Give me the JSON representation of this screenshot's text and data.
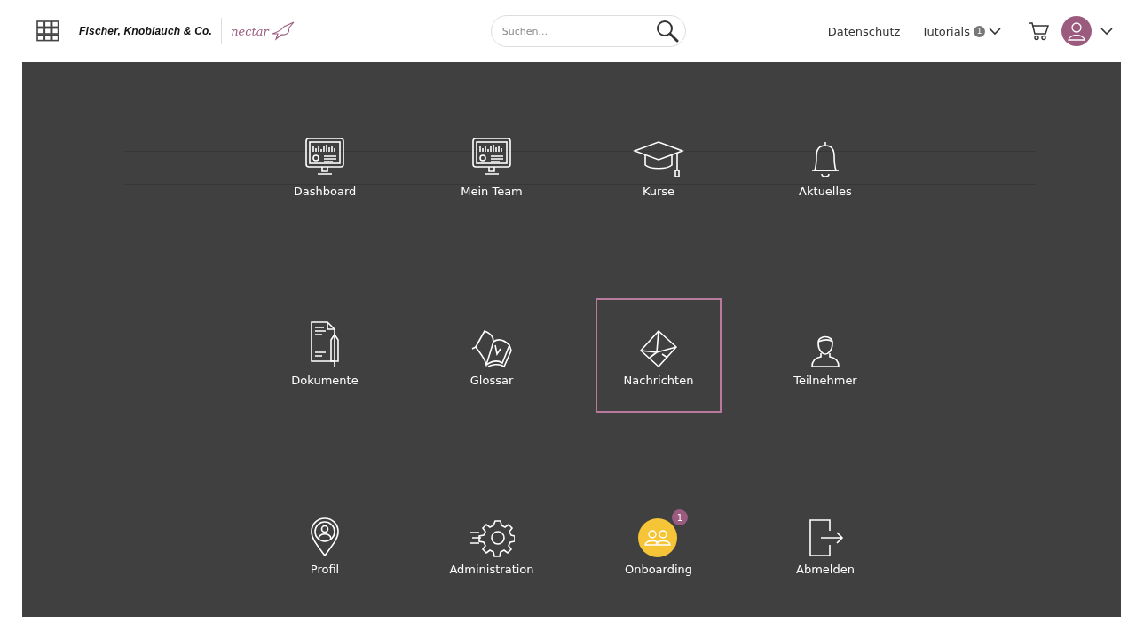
{
  "header": {
    "brand": "Fischer, Knoblauch & Co.",
    "product": "nectar",
    "search": {
      "placeholder": "Suchen..."
    },
    "links": [
      {
        "label": "Datenschutz"
      },
      {
        "label": "Tutorials",
        "badge": "1"
      }
    ]
  },
  "menu": [
    {
      "label": "Dashboard",
      "kind": "monitor",
      "selected": false
    },
    {
      "label": "Mein Team",
      "kind": "monitor",
      "selected": false
    },
    {
      "label": "Kurse",
      "kind": "cap",
      "selected": false
    },
    {
      "label": "Aktuelles",
      "kind": "bell",
      "selected": false
    },
    {
      "label": "Dokumente",
      "kind": "document",
      "selected": false
    },
    {
      "label": "Glossar",
      "kind": "book",
      "selected": false
    },
    {
      "label": "Nachrichten",
      "kind": "envelope",
      "selected": true
    },
    {
      "label": "Teilnehmer",
      "kind": "person",
      "selected": false
    },
    {
      "label": "Profil",
      "kind": "pin",
      "selected": false
    },
    {
      "label": "Administration",
      "kind": "gear",
      "selected": false
    },
    {
      "label": "Onboarding",
      "kind": "team",
      "selected": false,
      "badge": "1"
    },
    {
      "label": "Abmelden",
      "kind": "logout",
      "selected": false
    }
  ]
}
